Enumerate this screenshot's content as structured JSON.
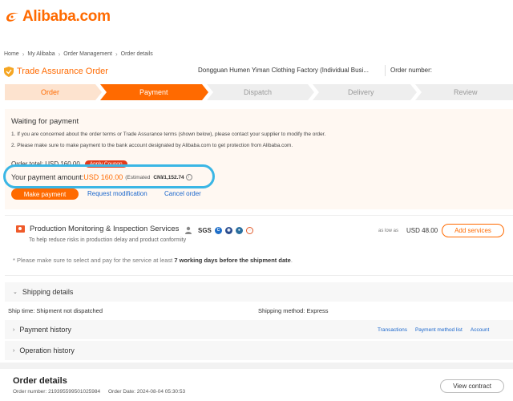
{
  "brand": {
    "name": "Alibaba.com",
    "accent": "#ff6a00"
  },
  "breadcrumb": [
    "Home",
    "My Alibaba",
    "Order Management",
    "Order details"
  ],
  "trade_assurance": {
    "title": "Trade Assurance Order",
    "supplier": "Dongguan Humen Yiman Clothing Factory (Individual Busi...",
    "order_number_label": "Order number:"
  },
  "steps": [
    "Order",
    "Payment",
    "Dispatch",
    "Delivery",
    "Review"
  ],
  "active_step": 1,
  "payment": {
    "status": "Waiting for payment",
    "notes": [
      "1. If you are concerned about the order terms or Trade Assurance terms (shown below), please contact your supplier to modify the order.",
      "2. Please make sure to make payment to the bank account designated by Alibaba.com to get protection from Alibaba.com."
    ],
    "order_total": "Order total: USD 160.00",
    "apply_coupon": "Apply Coupon",
    "amount_label": "Your payment amount:",
    "amount": "USD 160.00",
    "estimated": "(Estimated",
    "cny": "CN¥1,152.74",
    "make_payment": "Make payment",
    "request_modification": "Request modification",
    "cancel_order": "Cancel order"
  },
  "production": {
    "title": "Production Monitoring & Inspection Services",
    "subtitle": "To help reduce risks in production delay and product conformity",
    "as_low_as": "as low as",
    "price": "USD 48.00",
    "add_services": "Add services",
    "cert_logo": "SGS",
    "note_prefix": "* Please make sure to select and pay for the service at least ",
    "note_bold": "7 working days before the shipment date",
    "note_suffix": "."
  },
  "shipping": {
    "title": "Shipping details",
    "ship_time": "Ship time: Shipment not dispatched",
    "method": "Shipping method: Express"
  },
  "payment_history": {
    "title": "Payment history",
    "links": [
      "Transactions",
      "Payment method list",
      "Account"
    ]
  },
  "operation_history": {
    "title": "Operation history"
  },
  "order_details": {
    "title": "Order details",
    "order_number": "Order number: 219395599501025984",
    "order_date": "Order Date: 2024-08-04 05:30:53",
    "view_contract": "View contract"
  }
}
